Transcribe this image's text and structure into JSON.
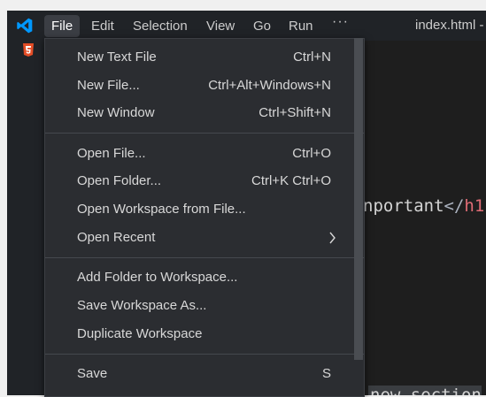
{
  "titlebar": {
    "menus": [
      "File",
      "Edit",
      "Selection",
      "View",
      "Go",
      "Run"
    ],
    "more": "···",
    "title": "index.html -"
  },
  "editor": {
    "line1_text": "nportant",
    "line1_close": "</",
    "line1_tag": "h1",
    "line2_text": "new section"
  },
  "file_menu": {
    "items": [
      {
        "label": "New Text File",
        "shortcut": "Ctrl+N"
      },
      {
        "label": "New File...",
        "shortcut": "Ctrl+Alt+Windows+N"
      },
      {
        "label": "New Window",
        "shortcut": "Ctrl+Shift+N"
      },
      {
        "label": "Open File...",
        "shortcut": "Ctrl+O"
      },
      {
        "label": "Open Folder...",
        "shortcut": "Ctrl+K Ctrl+O"
      },
      {
        "label": "Open Workspace from File...",
        "shortcut": ""
      },
      {
        "label": "Open Recent",
        "shortcut": ""
      },
      {
        "label": "Add Folder to Workspace...",
        "shortcut": ""
      },
      {
        "label": "Save Workspace As...",
        "shortcut": ""
      },
      {
        "label": "Duplicate Workspace",
        "shortcut": ""
      },
      {
        "label": "Save",
        "shortcut": "S"
      }
    ]
  },
  "colors": {
    "accent": "#0098ff",
    "menu_bg": "#2b2d31",
    "html_icon": "#e44d26"
  },
  "icons": {
    "logo": "vscode-logo-icon",
    "html_file": "html5-icon",
    "submenu": "chevron-right-icon"
  }
}
